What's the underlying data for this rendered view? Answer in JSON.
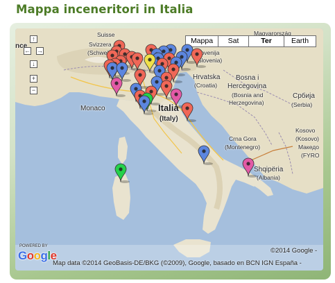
{
  "page": {
    "title": "Mappa inceneritori in Italia"
  },
  "colors": {
    "title": "#4d7c27",
    "sea": "#a5bfdd",
    "land": "#e9e3cf",
    "marker_red": "#f06757",
    "marker_blue": "#5c86df",
    "marker_pink": "#e25aa6",
    "marker_green": "#24d14b",
    "marker_yellow": "#f0e04a"
  },
  "map_type": {
    "buttons": [
      "Mappa",
      "Sat",
      "Ter",
      "Earth"
    ],
    "selected": "Ter"
  },
  "controls": {
    "pan_up": "↑",
    "pan_left": "←",
    "pan_right": "→",
    "pan_down": "↓",
    "zoom_in": "+",
    "zoom_out": "−",
    "icons": [
      "arrow-up-icon",
      "arrow-left-icon",
      "arrow-right-icon",
      "arrow-down-icon",
      "plus-icon",
      "minus-icon"
    ]
  },
  "labels": {
    "magyarorszag": "Magyarország",
    "suisse": "Suisse",
    "svizzera": "Svizzera",
    "schweiz": "(Schweiz)",
    "nce": "nce",
    "slovenija": "Slovenija",
    "slovenia": "(Slovenia)",
    "hrvatska": "Hrvatska",
    "croatia": "(Croatia)",
    "bosna_1": "Bosna i",
    "bosna_2": "Hercegovina",
    "bosna_3": "(Bosnia and",
    "bosna_4": "Herzegovina)",
    "srbija": "Србија",
    "serbia": "(Serbia)",
    "monaco": "Monaco",
    "italia": "Italia",
    "italy": "(Italy)",
    "crna_gora": "Crna Gora",
    "montenegro": "(Montenegro)",
    "kosovo": "Kosovo",
    "kosovo2": "(Kosovo)",
    "makedonija": "Македо",
    "fyro": "(FYRO",
    "shqiperia": "Shqipëria",
    "albania": "(Albania)"
  },
  "footer": {
    "powered_by": "POWERED BY",
    "google": [
      "G",
      "o",
      "o",
      "g",
      "l",
      "e"
    ],
    "copyright": "©2014 Google -",
    "attribution": "Map data ©2014 GeoBasis-DE/BKG (©2009), Google, basado en BCN IGN España -"
  }
}
